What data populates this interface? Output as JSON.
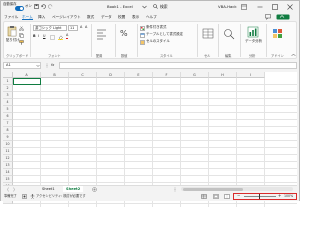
{
  "titlebar": {
    "autosave_label": "自動保存",
    "autosave_state": "オン",
    "doc_title": "Book1  -  Excel",
    "search_text": "検索",
    "user_name": "VBA-Hack"
  },
  "menu": {
    "items": [
      "ファイル",
      "ホーム",
      "挿入",
      "ページレイアウト",
      "数式",
      "データ",
      "校閲",
      "表示",
      "ヘルプ"
    ],
    "active_index": 1
  },
  "ribbon": {
    "clipboard": {
      "paste": "貼り付け",
      "label": "クリップボード"
    },
    "font": {
      "name": "游ゴシック Light",
      "size": "11",
      "label": "フォント"
    },
    "alignment": {
      "label": "配置"
    },
    "number": {
      "label": "数値"
    },
    "styles": {
      "conditional": "条件付き書式",
      "table": "テーブルとして書式設定",
      "cell": "セルのスタイル",
      "label": "スタイル"
    },
    "cells": {
      "label": "セル"
    },
    "editing": {
      "label": "編集"
    },
    "analysis": {
      "button": "データ分析",
      "label": "分析"
    },
    "addins": {
      "label": "アドイン"
    }
  },
  "formula_bar": {
    "name_box": "A1",
    "fx": "fx"
  },
  "grid": {
    "columns": [
      "A",
      "B",
      "C",
      "D",
      "E",
      "F",
      "G",
      "H",
      "I"
    ],
    "rows": [
      "1",
      "2",
      "3",
      "4",
      "5",
      "6",
      "7",
      "8",
      "9",
      "10",
      "11",
      "12",
      "13",
      "14",
      "15",
      "16",
      "17",
      "18"
    ]
  },
  "sheets": {
    "tabs": [
      "Sheet1",
      "Sheet2"
    ],
    "active_index": 1
  },
  "status": {
    "ready": "準備完了",
    "accessibility": "アクセシビリティ: 検討が必要です",
    "zoom": "100%"
  },
  "colors": {
    "excel_green": "#107c41",
    "accent_blue": "#0f6cbd",
    "highlight_red": "#d92b2b"
  }
}
